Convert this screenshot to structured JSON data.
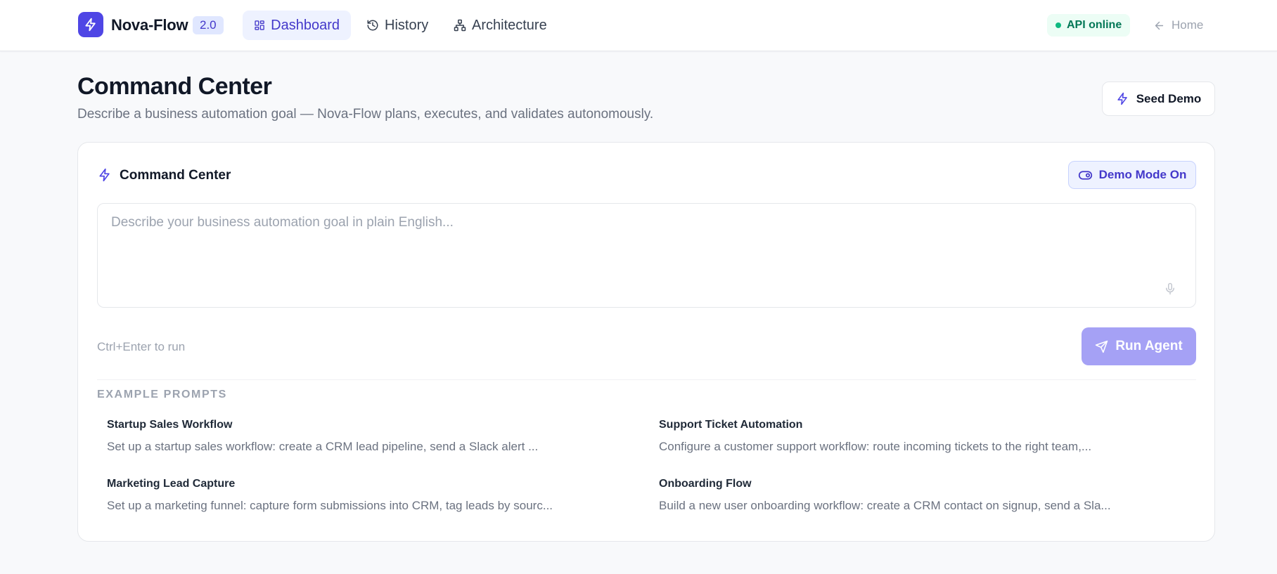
{
  "brand": {
    "name": "Nova-Flow",
    "version": "2.0"
  },
  "nav": {
    "items": [
      {
        "label": "Dashboard",
        "icon": "dashboard-icon",
        "active": true
      },
      {
        "label": "History",
        "icon": "history-icon",
        "active": false
      },
      {
        "label": "Architecture",
        "icon": "architecture-icon",
        "active": false
      }
    ],
    "status": "API online",
    "home": "Home"
  },
  "header": {
    "title": "Command Center",
    "subtitle": "Describe a business automation goal — Nova-Flow plans, executes, and validates autonomously.",
    "seed_button": "Seed Demo"
  },
  "command_card": {
    "title": "Command Center",
    "demo_toggle": "Demo Mode On",
    "input": {
      "value": "",
      "placeholder": "Describe your business automation goal in plain English..."
    },
    "hint": "Ctrl+Enter to run",
    "run_button": "Run Agent"
  },
  "examples": {
    "label": "EXAMPLE PROMPTS",
    "items": [
      {
        "title": "Startup Sales Workflow",
        "description": "Set up a startup sales workflow: create a CRM lead pipeline, send a Slack alert ..."
      },
      {
        "title": "Support Ticket Automation",
        "description": "Configure a customer support workflow: route incoming tickets to the right team,..."
      },
      {
        "title": "Marketing Lead Capture",
        "description": "Set up a marketing funnel: capture form submissions into CRM, tag leads by sourc..."
      },
      {
        "title": "Onboarding Flow",
        "description": "Build a new user onboarding workflow: create a CRM contact on signup, send a Sla..."
      }
    ]
  },
  "colors": {
    "accent": "#4f46e5",
    "accent_soft": "#eef2ff",
    "run_button_disabled": "#a5a1f5",
    "status_green": "#10b981"
  }
}
